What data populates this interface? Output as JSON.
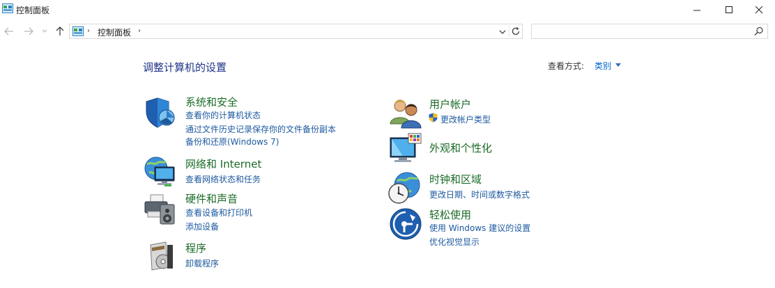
{
  "window": {
    "title": "控制面板"
  },
  "address": {
    "breadcrumb": "控制面板",
    "search_placeholder": ""
  },
  "content": {
    "heading": "调整计算机的设置",
    "view_by_label": "查看方式:",
    "view_by_value": "类别"
  },
  "categories": {
    "system": {
      "title": "系统和安全",
      "links": [
        "查看你的计算机状态",
        "通过文件历史记录保存你的文件备份副本",
        "备份和还原(Windows 7)"
      ]
    },
    "network": {
      "title": "网络和 Internet",
      "links": [
        "查看网络状态和任务"
      ]
    },
    "hardware": {
      "title": "硬件和声音",
      "links": [
        "查看设备和打印机",
        "添加设备"
      ]
    },
    "programs": {
      "title": "程序",
      "links": [
        "卸载程序"
      ]
    },
    "accounts": {
      "title": "用户帐户",
      "links": [
        "更改帐户类型"
      ]
    },
    "appearance": {
      "title": "外观和个性化",
      "links": []
    },
    "clock": {
      "title": "时钟和区域",
      "links": [
        "更改日期、时间或数字格式"
      ]
    },
    "ease": {
      "title": "轻松使用",
      "links": [
        "使用 Windows 建议的设置",
        "优化视觉显示"
      ]
    }
  },
  "icons": {
    "app": "control-panel-icon",
    "back": "back-arrow-icon",
    "forward": "forward-arrow-icon",
    "up": "up-arrow-icon",
    "refresh": "refresh-icon",
    "search": "search-icon"
  },
  "colors": {
    "heading": "#1e3287",
    "category_title": "#1a6b26",
    "link": "#1e5aa0"
  }
}
